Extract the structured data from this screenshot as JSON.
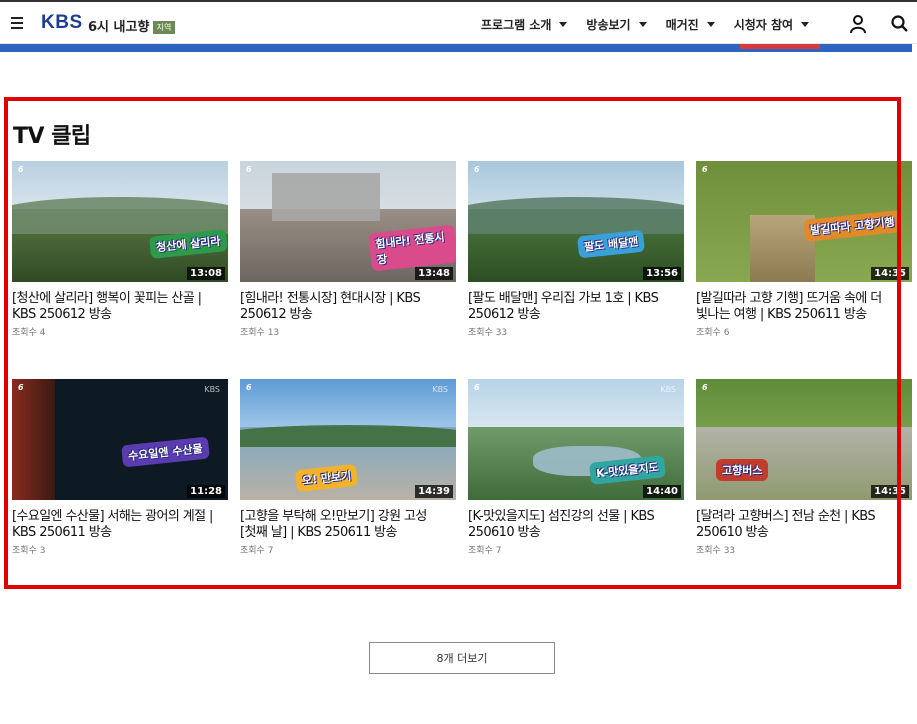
{
  "header": {
    "logo": "KBS",
    "program_title": "6시 내고향",
    "region_badge": "지역",
    "nav": [
      {
        "label": "프로그램 소개"
      },
      {
        "label": "방송보기"
      },
      {
        "label": "매거진"
      },
      {
        "label": "시청자 참여"
      }
    ],
    "icons": {
      "menu": "hamburger-menu-icon",
      "user": "user-icon",
      "search": "search-icon"
    },
    "colors": {
      "logo": "#1c3f94",
      "banner": "#2f63c2",
      "highlight": "#e00000"
    }
  },
  "section": {
    "title": "TV 클립",
    "clips": [
      {
        "title": "[청산에 살리라] 행복이 꽃피는 산골 | KBS 250612 방송",
        "views": "조회수 4",
        "duration": "13:08",
        "overlay": "청산에 살리라"
      },
      {
        "title": "[힘내라! 전통시장] 현대시장 | KBS 250612 방송",
        "views": "조회수 13",
        "duration": "13:48",
        "overlay": "힘내라! 전통시장"
      },
      {
        "title": "[팔도 배달맨] 우리집 가보 1호 | KBS 250612 방송",
        "views": "조회수 33",
        "duration": "13:56",
        "overlay": "팔도 배달맨"
      },
      {
        "title": "[발길따라 고향 기행] 뜨거움 속에 더 빛나는 여행 | KBS 250611 방송",
        "views": "조회수 6",
        "duration": "14:35",
        "overlay": "발길따라 고향기행"
      },
      {
        "title": "[수요일엔 수산물] 서해는 광어의 계절 | KBS 250611 방송",
        "views": "조회수 3",
        "duration": "11:28",
        "overlay": "수요일엔 수산물"
      },
      {
        "title": "[고향을 부탁해 오!만보기] 강원 고성 [첫째 날] | KBS 250611 방송",
        "views": "조회수 7",
        "duration": "14:39",
        "overlay": "오! 만보기"
      },
      {
        "title": "[K-맛있을지도] 섬진강의 선물 | KBS 250610 방송",
        "views": "조회수 7",
        "duration": "14:40",
        "overlay": "K-맛있을지도"
      },
      {
        "title": "[달려라 고향버스] 전남 순천 | KBS 250610 방송",
        "views": "조회수 33",
        "duration": "14:35",
        "overlay": "고향버스"
      }
    ]
  },
  "more_button": "8개 더보기"
}
